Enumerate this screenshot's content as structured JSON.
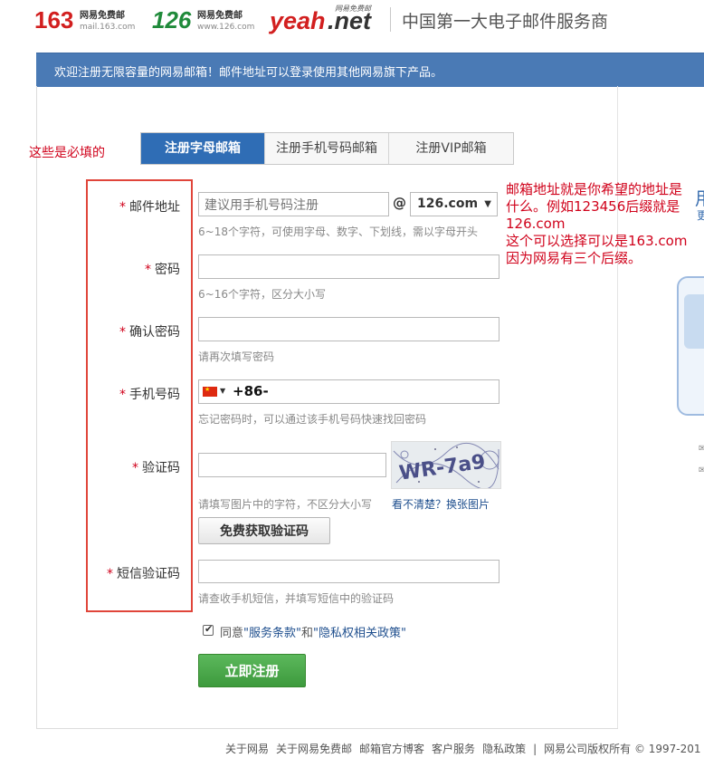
{
  "header": {
    "logo163": {
      "num": "163",
      "sub1": "网易免费邮",
      "sub2": "mail.163.com"
    },
    "logo126": {
      "num": "126",
      "sub1": "网易免费邮",
      "sub2": "www.126.com"
    },
    "logoYeah": {
      "main": "yeah",
      "dot": ".net",
      "tag": "网易免费邮"
    },
    "title": "中国第一大电子邮件服务商"
  },
  "banner": "欢迎注册无限容量的网易邮箱！邮件地址可以登录使用其他网易旗下产品。",
  "annotations": {
    "required_note": "这些是必填的",
    "email_note": [
      "邮箱地址就是你希望的地址是",
      "什么。例如123456后缀就是",
      "126.com",
      "这个可以选择可以是163.com",
      "因为网易有三个后缀。"
    ]
  },
  "tabs": [
    {
      "label": "注册字母邮箱"
    },
    {
      "label": "注册手机号码邮箱"
    },
    {
      "label": "注册VIP邮箱"
    }
  ],
  "required_mark": "*",
  "form": {
    "email": {
      "label": "邮件地址",
      "placeholder": "建议用手机号码注册",
      "at": "@",
      "domain": "126.com",
      "hint": "6~18个字符，可使用字母、数字、下划线，需以字母开头"
    },
    "password": {
      "label": "密码",
      "hint": "6~16个字符，区分大小写"
    },
    "confirm": {
      "label": "确认密码",
      "hint": "请再次填写密码"
    },
    "phone": {
      "label": "手机号码",
      "code": "+86-",
      "hint": "忘记密码时，可以通过该手机号码快速找回密码"
    },
    "captcha": {
      "label": "验证码",
      "hint": "请填写图片中的字符，不区分大小写",
      "refresh": "看不清楚？换张图片",
      "image_text": "WR-7a9"
    },
    "get_code_button": "免费获取验证码",
    "sms": {
      "label": "短信验证码",
      "hint": "请查收手机短信，并填写短信中的验证码"
    },
    "agree": {
      "prefix": "同意",
      "terms": "\"服务条款\"",
      "and": "和",
      "privacy": "\"隐私权相关政策\""
    },
    "submit": "立即注册"
  },
  "footer": [
    "关于网易",
    "关于网易免费邮",
    "邮箱官方博客",
    "客户服务",
    "隐私政策",
    "|",
    "网易公司版权所有 © 1997-201"
  ],
  "side": {
    "char1": "用",
    "char2": "更"
  },
  "colors": {
    "banner": "#4a7ab5",
    "tab_active": "#2f6db5",
    "required": "#d0021b",
    "submit": "#4aa84a"
  }
}
